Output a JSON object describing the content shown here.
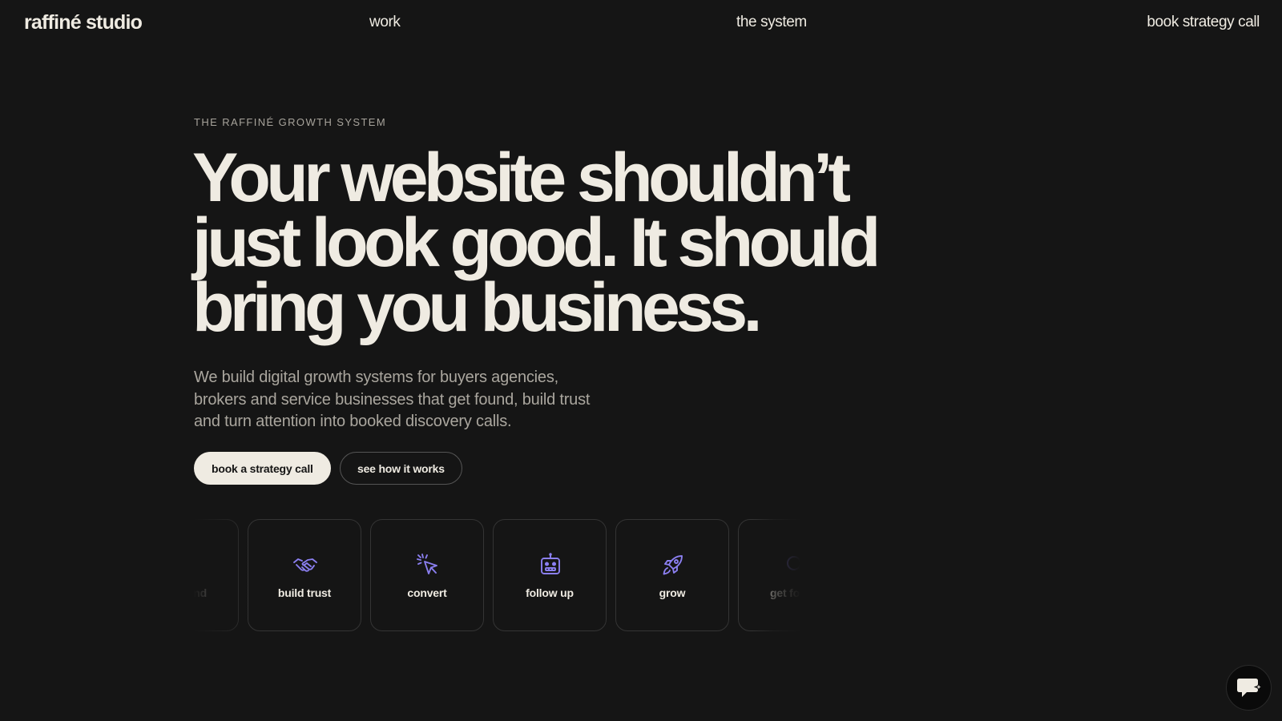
{
  "nav": {
    "logo": "raffiné studio",
    "links": {
      "work": "work",
      "system": "the system",
      "book": "book strategy call"
    }
  },
  "hero": {
    "eyebrow": "THE RAFFINÉ GROWTH SYSTEM",
    "headline": "Your website shouldn’t just look good. It should bring you business.",
    "subtext": "We build digital growth systems for buyers agencies, brokers and service businesses that get found, build trust and turn attention into booked discovery calls.",
    "primary_cta": "book a strategy call",
    "secondary_cta": "see how it works"
  },
  "steps": [
    {
      "label": "get found",
      "icon": "search-icon"
    },
    {
      "label": "build trust",
      "icon": "handshake-icon"
    },
    {
      "label": "convert",
      "icon": "cursor-click-icon"
    },
    {
      "label": "follow up",
      "icon": "robot-icon"
    },
    {
      "label": "grow",
      "icon": "rocket-icon"
    },
    {
      "label": "get found",
      "icon": "search-icon"
    }
  ],
  "colors": {
    "background": "#151515",
    "text": "#efebe2",
    "muted": "#aaa69e",
    "icon_accent": "#8b7ff0"
  }
}
